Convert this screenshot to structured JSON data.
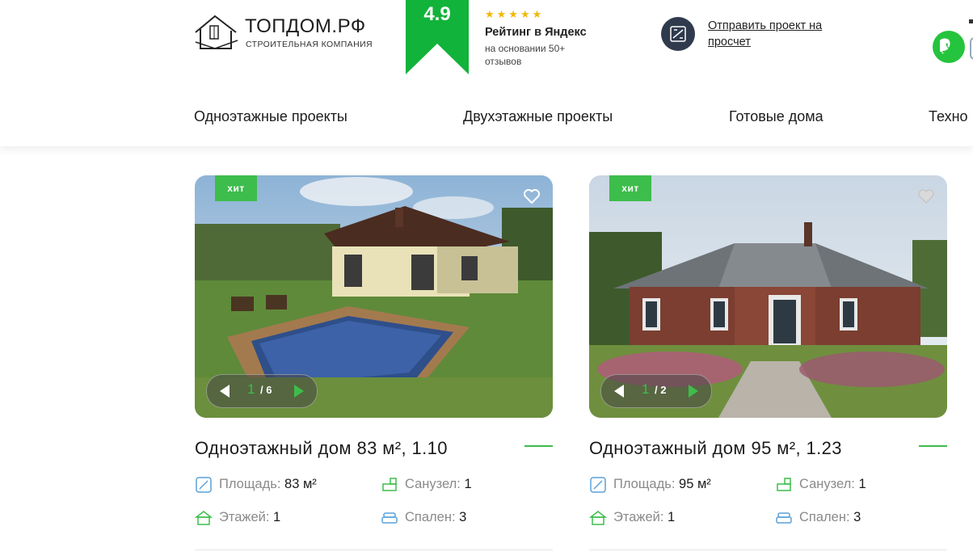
{
  "logo": {
    "name": "ТОПДОМ.РФ",
    "sub": "СТРОИТЕЛЬНАЯ КОМПАНИЯ",
    "icon": "house-logo-icon"
  },
  "rating": {
    "value": "4.9",
    "stars": "★★★★★",
    "title": "Рейтинг в Яндекс",
    "subtitle": "на основании 50+ отзывов"
  },
  "send_project": {
    "label": "Отправить проект на просчет",
    "icon": "calculator-icon"
  },
  "contacts": {
    "whatsapp_icon": "whatsapp-icon"
  },
  "nav": [
    "Одноэтажные проекты",
    "Двухэтажные проекты",
    "Готовые дома",
    "Техно"
  ],
  "colors": {
    "accent": "#3dbd4b",
    "dark": "#2f3b4d",
    "whatsapp": "#25c43e"
  },
  "labels": {
    "area": "Площадь:",
    "bathroom": "Санузел:",
    "floors": "Этажей:",
    "bedrooms": "Спален:"
  },
  "cards": [
    {
      "badge": "хит",
      "title": "Одноэтажный дом 83 м², 1.10",
      "slide_current": "1",
      "slide_total": "/ 6",
      "area": "83 м²",
      "bathroom": "1",
      "floors": "1",
      "bedrooms": "3"
    },
    {
      "badge": "хит",
      "title": "Одноэтажный дом 95 м², 1.23",
      "slide_current": "1",
      "slide_total": "/ 2",
      "area": "95 м²",
      "bathroom": "1",
      "floors": "1",
      "bedrooms": "3"
    }
  ]
}
